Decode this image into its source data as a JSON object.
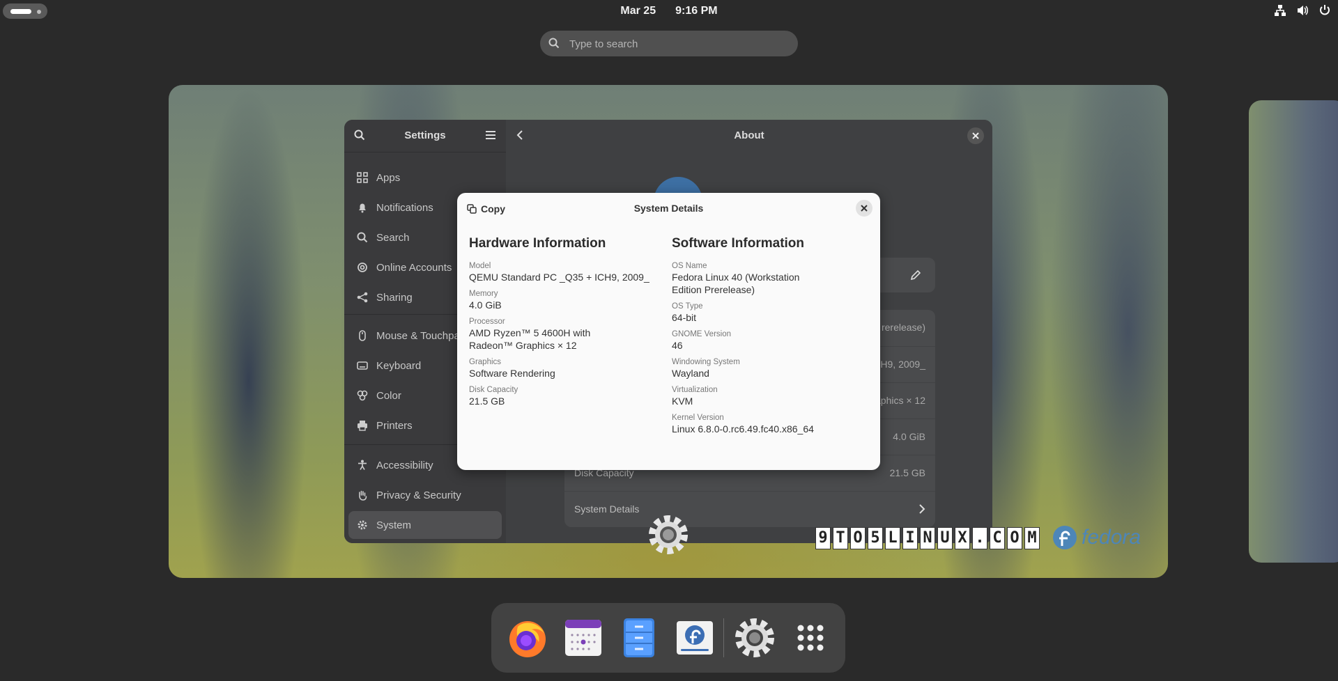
{
  "topbar": {
    "date": "Mar 25",
    "time": "9:16 PM"
  },
  "overview_search": {
    "placeholder": "Type to search"
  },
  "settings": {
    "sidebar_title": "Settings",
    "content_title": "About",
    "nav_items": [
      {
        "label": "Apps",
        "icon": "apps-grid-icon"
      },
      {
        "label": "Notifications",
        "icon": "bell-icon"
      },
      {
        "label": "Search",
        "icon": "search-icon"
      },
      {
        "label": "Online Accounts",
        "icon": "at-sign-icon"
      },
      {
        "label": "Sharing",
        "icon": "share-icon"
      },
      {
        "label": "Mouse & Touchpad",
        "icon": "mouse-icon"
      },
      {
        "label": "Keyboard",
        "icon": "keyboard-icon"
      },
      {
        "label": "Color",
        "icon": "color-icon"
      },
      {
        "label": "Printers",
        "icon": "printer-icon"
      },
      {
        "label": "Accessibility",
        "icon": "accessibility-icon"
      },
      {
        "label": "Privacy & Security",
        "icon": "hand-icon"
      },
      {
        "label": "System",
        "icon": "gear-icon"
      }
    ],
    "about_rows": [
      {
        "label": "",
        "value": "rerelease)"
      },
      {
        "label": "",
        "value": "H9, 2009_"
      },
      {
        "label": "",
        "value": "aphics × 12"
      },
      {
        "label": "",
        "value": "4.0 GiB"
      },
      {
        "label": "Disk Capacity",
        "value": "21.5 GB"
      },
      {
        "label": "System Details",
        "value": ""
      }
    ]
  },
  "dialog": {
    "copy_label": "Copy",
    "title": "System Details",
    "hardware": {
      "heading": "Hardware Information",
      "fields": [
        {
          "k": "Model",
          "v": "QEMU Standard PC _Q35 + ICH9, 2009_"
        },
        {
          "k": "Memory",
          "v": "4.0 GiB"
        },
        {
          "k": "Processor",
          "v": "AMD Ryzen™ 5 4600H with\nRadeon™ Graphics × 12"
        },
        {
          "k": "Graphics",
          "v": "Software Rendering"
        },
        {
          "k": "Disk Capacity",
          "v": "21.5 GB"
        }
      ]
    },
    "software": {
      "heading": "Software Information",
      "fields": [
        {
          "k": "OS Name",
          "v": "Fedora Linux 40 (Workstation\nEdition Prerelease)"
        },
        {
          "k": "OS Type",
          "v": "64-bit"
        },
        {
          "k": "GNOME Version",
          "v": "46"
        },
        {
          "k": "Windowing System",
          "v": "Wayland"
        },
        {
          "k": "Virtualization",
          "v": "KVM"
        },
        {
          "k": "Kernel Version",
          "v": "Linux 6.8.0-0.rc6.49.fc40.x86_64"
        }
      ]
    }
  },
  "watermark": {
    "chars": [
      "9",
      "T",
      "O",
      "5",
      "L",
      "I",
      "N",
      "U",
      "X",
      ".",
      "C",
      "O",
      "M"
    ],
    "fedora": "fedora"
  },
  "dock": {
    "items": [
      "firefox-icon",
      "calendar-icon",
      "files-icon",
      "software-icon",
      "settings-icon",
      "app-grid-icon"
    ]
  },
  "colors": {
    "panel_bg": "#2a2a2a",
    "dialog_bg": "#fafafa",
    "fedora_blue": "#4d86b8"
  }
}
